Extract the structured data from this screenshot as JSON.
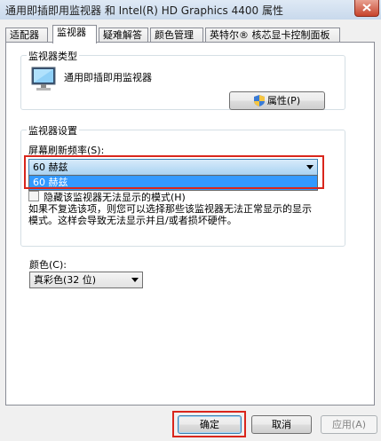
{
  "window": {
    "title": "通用即插即用监视器 和 Intel(R) HD Graphics 4400 属性"
  },
  "tabs": [
    {
      "label": "适配器"
    },
    {
      "label": "监视器",
      "active": true
    },
    {
      "label": "疑难解答"
    },
    {
      "label": "颜色管理"
    },
    {
      "label": "英特尔® 核芯显卡控制面板"
    }
  ],
  "monitor_type": {
    "group_label": "监视器类型",
    "monitor_name": "通用即插即用监视器",
    "properties_button": "属性(P)"
  },
  "monitor_settings": {
    "group_label": "监视器设置",
    "refresh_label": "屏幕刷新频率(S):",
    "refresh_value": "60 赫兹",
    "refresh_options": [
      "60 赫兹"
    ],
    "hide_modes_checkbox": "隐藏该监视器无法显示的模式(H)",
    "hide_modes_checked": false,
    "description": "如果不复选该项，则您可以选择那些该监视器无法正常显示的显示模式。这样会导致无法显示并且/或者损坏硬件。"
  },
  "colors": {
    "label": "颜色(C):",
    "value": "真彩色(32 位)"
  },
  "buttons": {
    "ok": "确定",
    "cancel": "取消",
    "apply": "应用(A)"
  }
}
